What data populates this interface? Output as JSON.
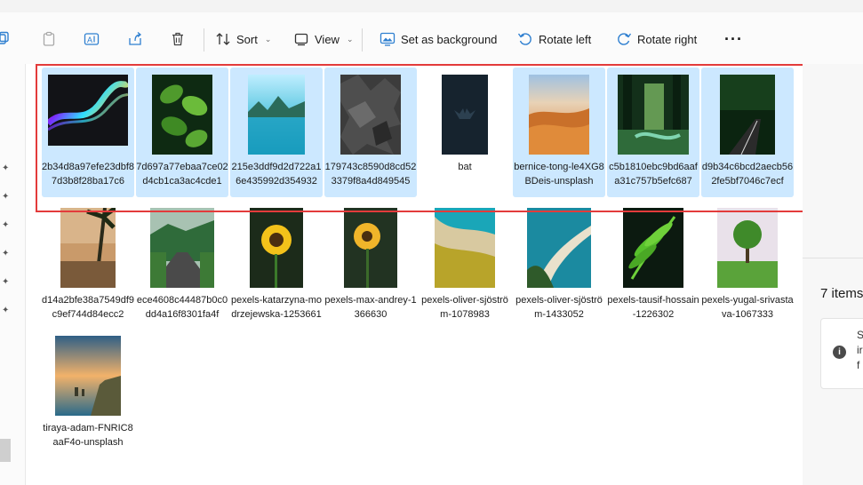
{
  "toolbar": {
    "sort_label": "Sort",
    "view_label": "View",
    "set_background_label": "Set as background",
    "rotate_left_label": "Rotate left",
    "rotate_right_label": "Rotate right",
    "more_label": "···"
  },
  "files_row1": [
    {
      "name": "2b34d8a97efe23dbf87d3b8f28ba17c6",
      "selected": true
    },
    {
      "name": "7d697a77ebaa7ce02d4cb1ca3ac4cde1",
      "selected": true
    },
    {
      "name": "215e3ddf9d2d722a16e435992d354932",
      "selected": true
    },
    {
      "name": "179743c8590d8cd523379f8a4d849545",
      "selected": true
    },
    {
      "name": "bat",
      "selected": false
    },
    {
      "name": "bernice-tong-le4XG8BDeis-unsplash",
      "selected": true
    },
    {
      "name": "c5b1810ebc9bd6aafa31c757b5efc687",
      "selected": true
    },
    {
      "name": "d9b34c6bcd2aecb562fe5bf7046c7ecf",
      "selected": true
    }
  ],
  "files_row2": [
    {
      "name": "d14a2bfe38a7549df9c9ef744d84ecc2"
    },
    {
      "name": "ece4608c44487b0c0dd4a16f8301fa4f"
    },
    {
      "name": "pexels-katarzyna-modrzejewska-1253661"
    },
    {
      "name": "pexels-max-andrey-1366630"
    },
    {
      "name": "pexels-oliver-sjöström-1078983"
    },
    {
      "name": "pexels-oliver-sjöström-1433052"
    },
    {
      "name": "pexels-tausif-hossain-1226302"
    },
    {
      "name": "pexels-yugal-srivastava-1067333"
    }
  ],
  "files_row3": [
    {
      "name": "tiraya-adam-FNRIC8aaF4o-unsplash"
    }
  ],
  "details": {
    "items_selected": "7 items",
    "info_text_line1": "S",
    "info_text_line2": "ir",
    "info_text_line3": "f"
  },
  "colors": {
    "selection": "#cce8ff",
    "highlight_box": "#e33b3b"
  }
}
